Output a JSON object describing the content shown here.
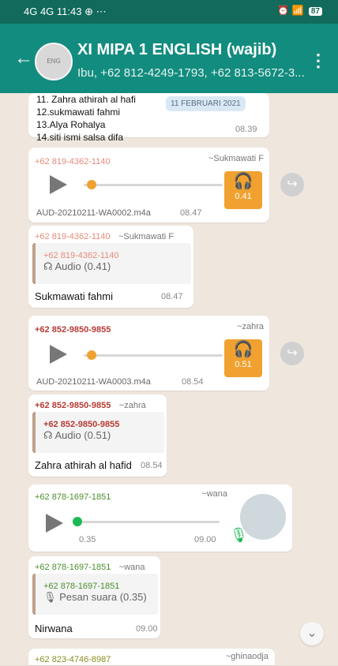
{
  "status_bar": {
    "signal": "4G 4G",
    "time": "11:43",
    "extra": "⊕ ⋯",
    "battery": "87"
  },
  "header": {
    "title": "XI MIPA 1 ENGLISH (wajib)",
    "subtitle": "Ibu, +62 812-4249-1793, +62 813-5672-3..."
  },
  "list": {
    "items": [
      "11. Zahra athirah al hafi",
      "12.sukmawati fahmi",
      "13.Alya Rohalya",
      "14.siti ismi salsa difa"
    ],
    "date_chip": "11 FEBRUARI 2021",
    "time": "08.39"
  },
  "messages": [
    {
      "sender": "+62 819-4362-1140",
      "alias": "~Sukmawati F",
      "file": "AUD-20210211-WA0002.m4a",
      "time": "08.47",
      "duration": "0.41"
    },
    {
      "sender": "+62 819-4362-1140",
      "alias": "~Sukmawati F",
      "quote_sender": "+62 819-4362-1140",
      "quote_text": "☊ Audio (0.41)",
      "text": "Sukmawati fahmi",
      "time": "08.47"
    },
    {
      "sender": "+62 852-9850-9855",
      "alias": "~zahra",
      "file": "AUD-20210211-WA0003.m4a",
      "time": "08.54",
      "duration": "0.51"
    },
    {
      "sender": "+62 852-9850-9855",
      "alias": "~zahra",
      "quote_sender": "+62 852-9850-9855",
      "quote_text": "☊ Audio (0.51)",
      "text": "Zahra athirah al hafid",
      "time": "08.54"
    },
    {
      "sender": "+62 878-1697-1851",
      "alias": "~wana",
      "duration": "0.35",
      "time": "09.00"
    },
    {
      "sender": "+62 878-1697-1851",
      "alias": "~wana",
      "quote_sender": "+62 878-1697-1851",
      "quote_text": "🎙 Pesan suara (0.35)",
      "text": "Nirwana",
      "time": "09.00"
    },
    {
      "sender": "+62 823-4746-8987",
      "alias": "~ghinaodja"
    }
  ],
  "colors": {
    "header": "#128c7e",
    "audio_accent": "#f0a12f",
    "voice_dot": "#1db954"
  }
}
